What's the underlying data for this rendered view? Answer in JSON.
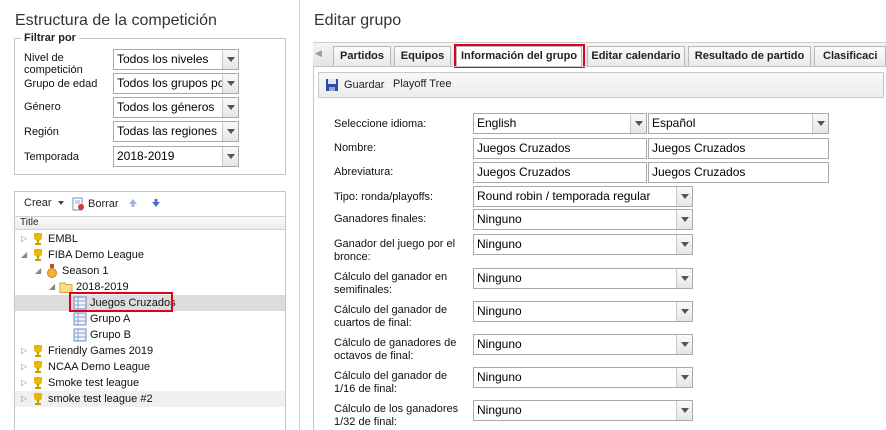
{
  "left": {
    "title": "Estructura de la competición",
    "filter": {
      "legend": "Filtrar por",
      "fields": [
        {
          "label": "Nivel de competición",
          "value": "Todos los niveles"
        },
        {
          "label": "Grupo de edad",
          "value": "Todos los grupos por"
        },
        {
          "label": "Género",
          "value": "Todos los géneros"
        },
        {
          "label": "Región",
          "value": "Todas las regiones"
        },
        {
          "label": "Temporada",
          "value": "2018-2019"
        }
      ]
    },
    "toolbar": {
      "create": "Crear",
      "delete": "Borrar"
    },
    "tree": {
      "header": "Title",
      "items": [
        {
          "label": "EMBL"
        },
        {
          "label": "FIBA Demo League"
        },
        {
          "label": "Season 1"
        },
        {
          "label": "2018-2019"
        },
        {
          "label": "Juegos Cruzados"
        },
        {
          "label": "Grupo A"
        },
        {
          "label": "Grupo B"
        },
        {
          "label": "Friendly Games 2019"
        },
        {
          "label": "NCAA Demo League"
        },
        {
          "label": "Smoke test league"
        },
        {
          "label": "smoke test league #2"
        }
      ]
    }
  },
  "right": {
    "title": "Editar grupo",
    "tabs": [
      {
        "label": "Partidos"
      },
      {
        "label": "Equipos"
      },
      {
        "label": "Información del grupo"
      },
      {
        "label": "Editar calendario"
      },
      {
        "label": "Resultado de partido"
      },
      {
        "label": "Clasificaci"
      }
    ],
    "actions": {
      "save": "Guardar",
      "playoff": "Playoff Tree"
    },
    "form": {
      "language": {
        "label": "Seleccione idioma:",
        "lang1": "English",
        "lang2": "Español"
      },
      "name": {
        "label": "Nombre:",
        "value1": "Juegos Cruzados",
        "value2": "Juegos Cruzados"
      },
      "abbr": {
        "label": "Abreviatura:",
        "value1": "Juegos Cruzados",
        "value2": "Juegos Cruzados"
      },
      "type": {
        "label": "Tipo: ronda/playoffs:",
        "value": "Round robin / temporada regular"
      },
      "selects": [
        {
          "label": "Ganadores finales:",
          "value": "Ninguno"
        },
        {
          "label": "Ganador del juego por el bronce:",
          "value": "Ninguno"
        },
        {
          "label": "Cálculo del ganador en semifinales:",
          "value": "Ninguno"
        },
        {
          "label": "Cálculo del ganador de cuartos de final:",
          "value": "Ninguno"
        },
        {
          "label": "Cálculo de ganadores de octavos de final:",
          "value": "Ninguno"
        },
        {
          "label": "Cálculo del ganador de 1/16 de final:",
          "value": "Ninguno"
        },
        {
          "label": "Cálculo de los ganadores 1/32 de final:",
          "value": "Ninguno"
        }
      ]
    }
  },
  "colors": {
    "highlight": "#e0001b",
    "trophy": "#e6b800"
  }
}
